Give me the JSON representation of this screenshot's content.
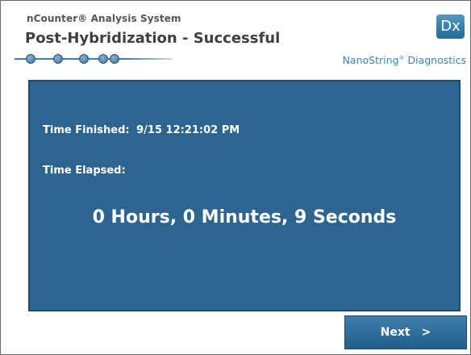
{
  "header": {
    "system_name": "nCounter® Analysis System",
    "screen_title": "Post-Hybridization - Successful",
    "progress_steps": 5,
    "progress_current": 5
  },
  "brand": {
    "logo_text": "Dx",
    "name": "NanoString",
    "reg": "®",
    "division": "Diagnostics",
    "accent_color": "#2c6590"
  },
  "panel": {
    "finished_label": "Time Finished:",
    "finished_value": "9/15 12:21:02 PM",
    "elapsed_label": "Time Elapsed:",
    "elapsed_value": "0 Hours, 0 Minutes, 9 Seconds"
  },
  "footer": {
    "next_label": "Next",
    "next_icon": "chevron-right-icon",
    "next_glyph": ">"
  }
}
